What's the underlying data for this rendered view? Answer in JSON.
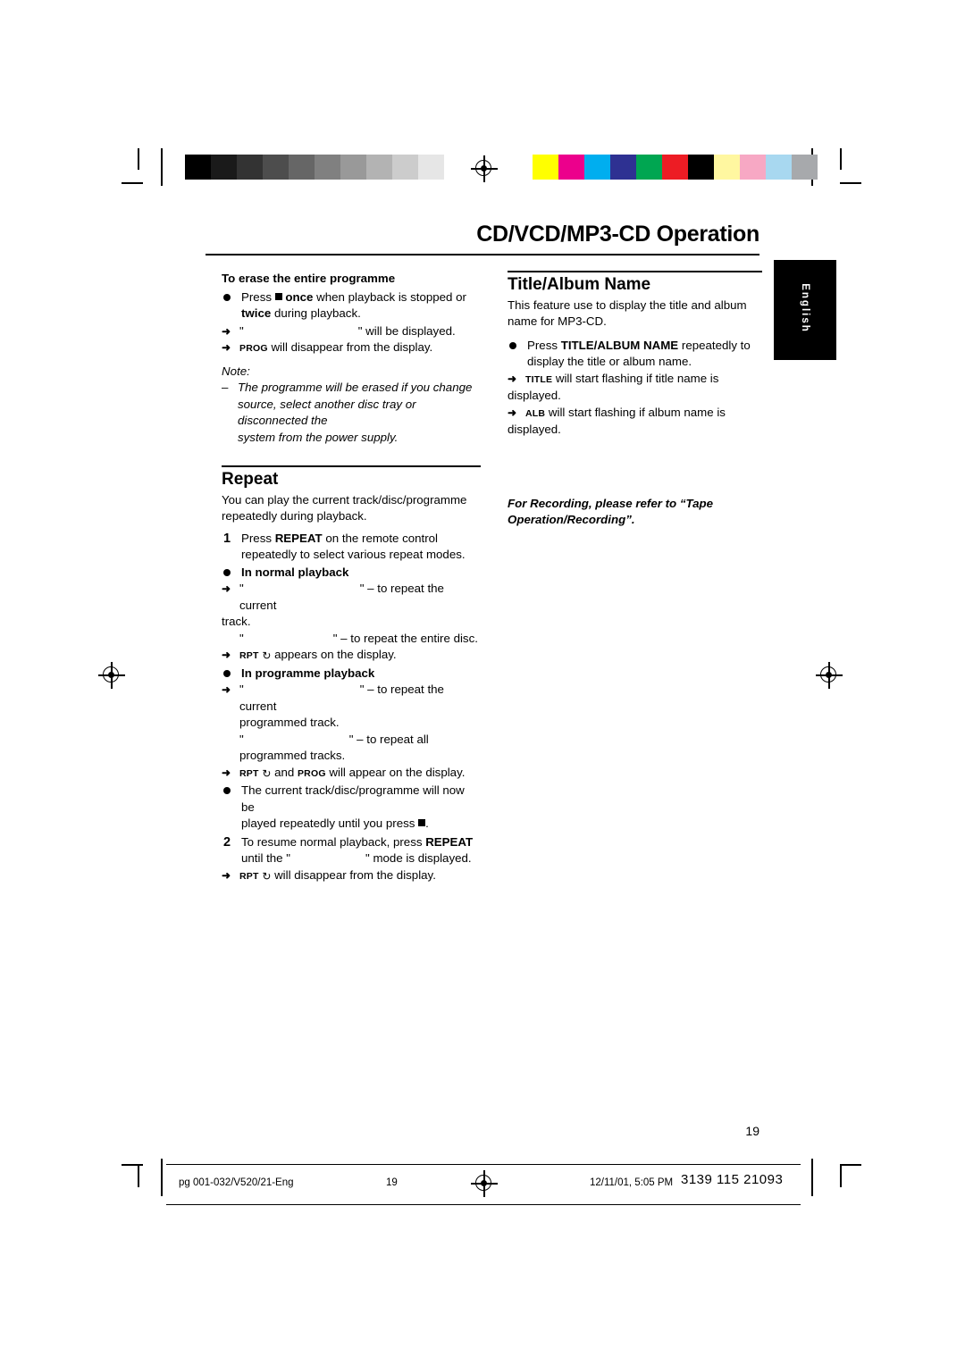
{
  "page": {
    "title": "CD/VCD/MP3-CD Operation",
    "language_tab": "English",
    "page_number": "19"
  },
  "colorbar": {
    "gray_swatches": [
      "#000000",
      "#1a1a1a",
      "#333333",
      "#4d4d4d",
      "#666666",
      "#808080",
      "#999999",
      "#b3b3b3",
      "#cccccc",
      "#e6e6e6",
      "#ffffff"
    ],
    "color_swatches": [
      "#ffff00",
      "#ec008c",
      "#00aeef",
      "#2e3192",
      "#00a651",
      "#ed1c24",
      "#000000",
      "#fff7a0",
      "#f7a8c4",
      "#a8d8f0",
      "#a7a9ac"
    ]
  },
  "left_column": {
    "erase_heading": "To erase the entire programme",
    "erase_press_pre": "Press",
    "erase_once": "once",
    "erase_mid": "when playback is stopped or",
    "erase_twice": "twice",
    "erase_end": "during playback.",
    "erase_display_quote_open": "\"",
    "erase_display_quote_close": "\"",
    "erase_display_tail": "will be displayed.",
    "erase_prog_label": "PROG",
    "erase_prog_tail": "will disappear from the display.",
    "note_label": "Note:",
    "note_line1": "The programme will be erased if you change",
    "note_line2": "source, select another disc tray or disconnected the",
    "note_line3": "system from the power supply.",
    "repeat_heading": "Repeat",
    "repeat_intro_1": "You can play the current track/disc/programme",
    "repeat_intro_2": "repeatedly during playback.",
    "step1_num": "1",
    "step1_pre": "Press",
    "step1_bold": "REPEAT",
    "step1_post": "on the remote control",
    "step1_line2": "repeatedly to select various repeat modes.",
    "normal_playback_heading": "In normal playback",
    "normal_a_quote_open": "\"",
    "normal_a_quote_close": "\"",
    "normal_a_tail": "– to repeat the current",
    "normal_a_tail2": "track.",
    "normal_b_quote_open": "\"",
    "normal_b_quote_close": "\"",
    "normal_b_tail": "– to repeat the entire disc.",
    "normal_rpt_label": "RPT",
    "normal_rpt_tail": "appears on the display.",
    "programme_playback_heading": "In programme playback",
    "prog_a_quote_open": "\"",
    "prog_a_quote_close": "\"",
    "prog_a_tail": "– to repeat the current",
    "prog_a_tail2": "programmed track.",
    "prog_b_quote_open": "\"",
    "prog_b_quote_close": "\"",
    "prog_b_tail": "– to repeat all",
    "prog_b_tail2": "programmed tracks.",
    "prog_rpt_label": "RPT",
    "prog_and": "and",
    "prog_prog_label": "PROG",
    "prog_rpt_tail": "will appear on the display.",
    "current_track_1": "The current track/disc/programme will now be",
    "current_track_2": "played repeatedly until you press",
    "current_track_3": ".",
    "step2_num": "2",
    "step2_pre": "To resume normal playback, press",
    "step2_bold": "REPEAT",
    "step2_line2_pre": "until the",
    "step2_quote_open": "\"",
    "step2_quote_close": "\"",
    "step2_line2_post": "mode is displayed.",
    "step2_rpt_label": "RPT",
    "step2_rpt_tail": "will disappear from the display."
  },
  "right_column": {
    "title_album_heading": "Title/Album Name",
    "intro_1": "This feature use to display the title and album",
    "intro_2": "name for MP3-CD.",
    "press_pre": "Press",
    "press_bold": "TITLE/ALBUM NAME",
    "press_post": "repeatedly to",
    "press_line2": "display the title or album name.",
    "title_label": "TITLE",
    "title_tail_1": "will start flashing if title name is",
    "title_tail_2": "displayed.",
    "alb_label": "ALB",
    "alb_tail_1": "will start flashing if album name is",
    "alb_tail_2": "displayed.",
    "recording_note_1": "For Recording, please refer to “Tape",
    "recording_note_2": "Operation/Recording”."
  },
  "footer": {
    "file": "pg 001-032/V520/21-Eng",
    "page": "19",
    "date": "12/11/01, 5:05 PM",
    "code": "3139 115 21093"
  }
}
